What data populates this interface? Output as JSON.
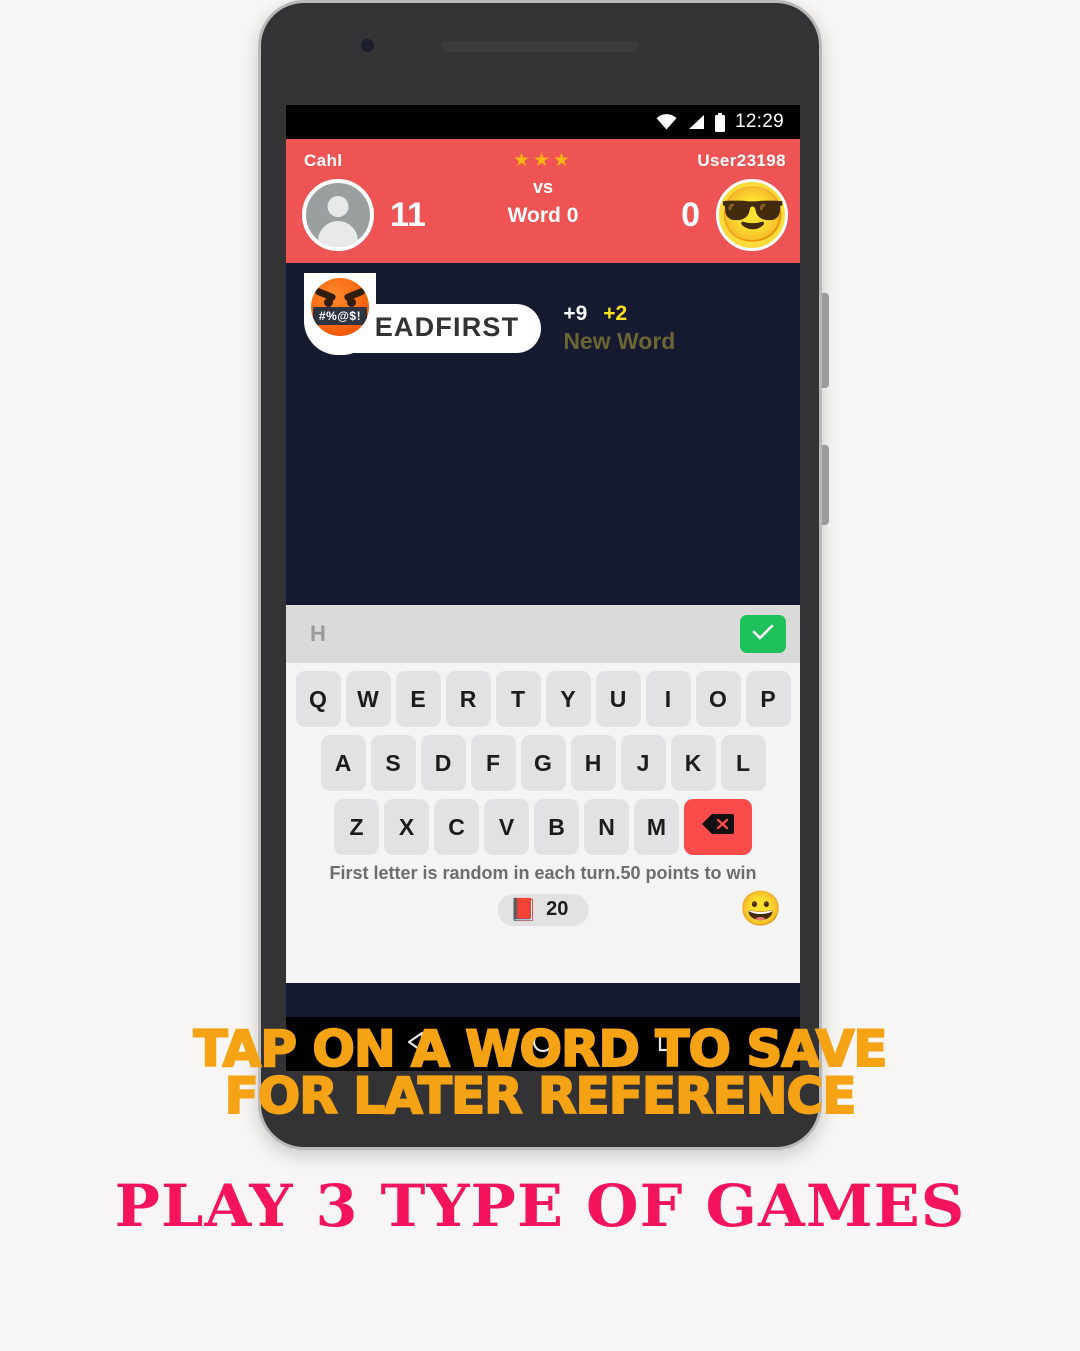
{
  "status_bar": {
    "clock": "12:29",
    "icons": [
      "wifi-icon",
      "signal-icon",
      "battery-icon"
    ]
  },
  "score_header": {
    "background_color": "#ef5454",
    "left_player": {
      "name": "Cahl",
      "score": "11",
      "avatar": "default-person-avatar"
    },
    "right_player": {
      "name": "User23198",
      "score": "0",
      "avatar": "sunglasses-emoji",
      "avatar_glyph": "😎"
    },
    "center": {
      "stars": "★★★",
      "star_color": "#fcb314",
      "vs_label": "vs",
      "round_label": "Word 0"
    }
  },
  "board": {
    "background_color": "#151a30",
    "entry": {
      "word": "HEADFIRST",
      "points_base": "+9",
      "points_bonus": "+2",
      "status_label": "New Word",
      "bonus_color": "#ffe11b",
      "avatar": "angry-swearing-emoji",
      "censor_text": "#%@$!"
    }
  },
  "input_bar": {
    "value": "H",
    "placeholder": "H",
    "submit_label": "check-icon",
    "submit_color": "#1fc15b"
  },
  "keyboard": {
    "rows": [
      [
        "Q",
        "W",
        "E",
        "R",
        "T",
        "Y",
        "U",
        "I",
        "O",
        "P"
      ],
      [
        "A",
        "S",
        "D",
        "F",
        "G",
        "H",
        "J",
        "K",
        "L"
      ],
      [
        "Z",
        "X",
        "C",
        "V",
        "B",
        "N",
        "M"
      ]
    ],
    "backspace_label": "⌫",
    "backspace_color": "#fa4b4b",
    "hint": "First letter is random in each turn.50 points to win",
    "dictionary": {
      "icon": "📕",
      "count": "20"
    },
    "emoji_button": "😀"
  },
  "nav_bar": {
    "items": [
      "back-button",
      "home-button",
      "recents-button"
    ]
  },
  "promo": {
    "caption_line1": "TAP ON A WORD TO SAVE",
    "caption_line2": "FOR LATER REFERENCE",
    "caption_color": "#f5a215",
    "headline": "PLAY 3 TYPE OF GAMES",
    "headline_color": "#f4145b"
  }
}
